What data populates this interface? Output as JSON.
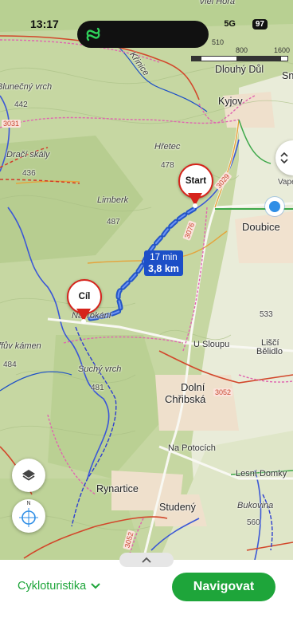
{
  "status_bar": {
    "time": "13:17",
    "network": "5G",
    "battery": "97"
  },
  "scale_bar": {
    "ticks": [
      "0",
      "510",
      "800",
      "1600"
    ]
  },
  "map": {
    "labels": [
      {
        "name": "label-viel-hora",
        "text": "Viel Hora",
        "cls": "lbl i"
      },
      {
        "name": "label-dlouhy-dul",
        "text": "Dlouhý Důl",
        "cls": "lbl big"
      },
      {
        "name": "label-sn",
        "text": "Sn",
        "cls": "lbl big"
      },
      {
        "name": "label-kyjov",
        "text": "Kyjov",
        "cls": "lbl big"
      },
      {
        "name": "label-blunecny-vrch",
        "text": "Blunečný vrch",
        "cls": "lbl i"
      },
      {
        "name": "label-442",
        "text": "442",
        "cls": "lbl num"
      },
      {
        "name": "label-3031",
        "text": "3031",
        "cls": "road-no"
      },
      {
        "name": "label-hretec",
        "text": "Hřetec",
        "cls": "lbl i"
      },
      {
        "name": "label-478",
        "text": "478",
        "cls": "lbl num"
      },
      {
        "name": "label-draci-skaly",
        "text": "Dračí skály",
        "cls": "lbl i"
      },
      {
        "name": "label-436",
        "text": "436",
        "cls": "lbl num"
      },
      {
        "name": "label-limberk",
        "text": "Limberk",
        "cls": "lbl i"
      },
      {
        "name": "label-487",
        "text": "487",
        "cls": "lbl num"
      },
      {
        "name": "label-doubice",
        "text": "Doubice",
        "cls": "lbl town"
      },
      {
        "name": "label-vape",
        "text": "Vape",
        "cls": "lbl num"
      },
      {
        "name": "label-3029",
        "text": "3029",
        "cls": "road-no"
      },
      {
        "name": "label-3076",
        "text": "3076",
        "cls": "road-no"
      },
      {
        "name": "label-nadrazi",
        "text": "Na Tokání",
        "cls": "lbl i"
      },
      {
        "name": "label-533",
        "text": "533",
        "cls": "lbl num"
      },
      {
        "name": "label-u-sloupu",
        "text": "U Sloupu",
        "cls": "lbl"
      },
      {
        "name": "label-lisci-belidlo-1",
        "text": "Liščí",
        "cls": "lbl"
      },
      {
        "name": "label-lisci-belidlo-2",
        "text": "Bělidlo",
        "cls": "lbl"
      },
      {
        "name": "label-ruv-kamen",
        "text": "ffův kámen",
        "cls": "lbl i"
      },
      {
        "name": "label-484",
        "text": "484",
        "cls": "lbl num"
      },
      {
        "name": "label-suchy-vrch",
        "text": "Suchý vrch",
        "cls": "lbl i"
      },
      {
        "name": "label-481",
        "text": "481",
        "cls": "lbl num"
      },
      {
        "name": "label-dolni",
        "text": "Dolní",
        "cls": "lbl town"
      },
      {
        "name": "label-chribska",
        "text": "Chřibská",
        "cls": "lbl town"
      },
      {
        "name": "label-3052",
        "text": "3052",
        "cls": "road-no"
      },
      {
        "name": "label-na-potocich",
        "text": "Na Potocích",
        "cls": "lbl"
      },
      {
        "name": "label-lesni-domky",
        "text": "Lesní Domky",
        "cls": "lbl"
      },
      {
        "name": "label-rynartice",
        "text": "Rynartice",
        "cls": "lbl big"
      },
      {
        "name": "label-studeny",
        "text": "Studený",
        "cls": "lbl big"
      },
      {
        "name": "label-bukovina",
        "text": "Bukovina",
        "cls": "lbl i"
      },
      {
        "name": "label-560",
        "text": "560",
        "cls": "lbl num"
      },
      {
        "name": "label-kirnice",
        "text": "Křinice",
        "cls": "lbl i"
      },
      {
        "name": "label-3052b",
        "text": "3052",
        "cls": "road-no"
      }
    ],
    "start_pin": "Start",
    "end_pin": "Cíl",
    "route_summary": {
      "duration": "17 min",
      "distance": "3,8 km"
    }
  },
  "colors": {
    "accent": "#1ea53a",
    "route": "#1c4fc7",
    "pin": "#d6231b"
  },
  "controls": {
    "layers_icon": "layers-icon",
    "compass_icon": "compass-icon",
    "compass_letter": "N"
  },
  "bottom_panel": {
    "profile_label": "Cykloturistika",
    "navigate_label": "Navigovat"
  }
}
